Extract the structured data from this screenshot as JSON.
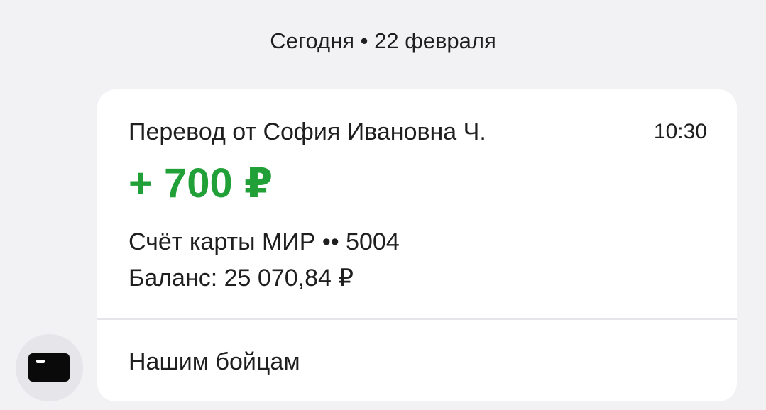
{
  "date_header": "Сегодня • 22 февраля",
  "transaction": {
    "title": "Перевод от София Ивановна Ч.",
    "time": "10:30",
    "amount": "+ 700 ₽",
    "account": "Счёт карты МИР •• 5004",
    "balance": "Баланс: 25 070,84 ₽",
    "message": "Нашим бойцам"
  },
  "icons": {
    "avatar": "bank-card-icon"
  },
  "colors": {
    "amount": "#21a038",
    "background": "#f2f2f5",
    "card": "#ffffff"
  }
}
